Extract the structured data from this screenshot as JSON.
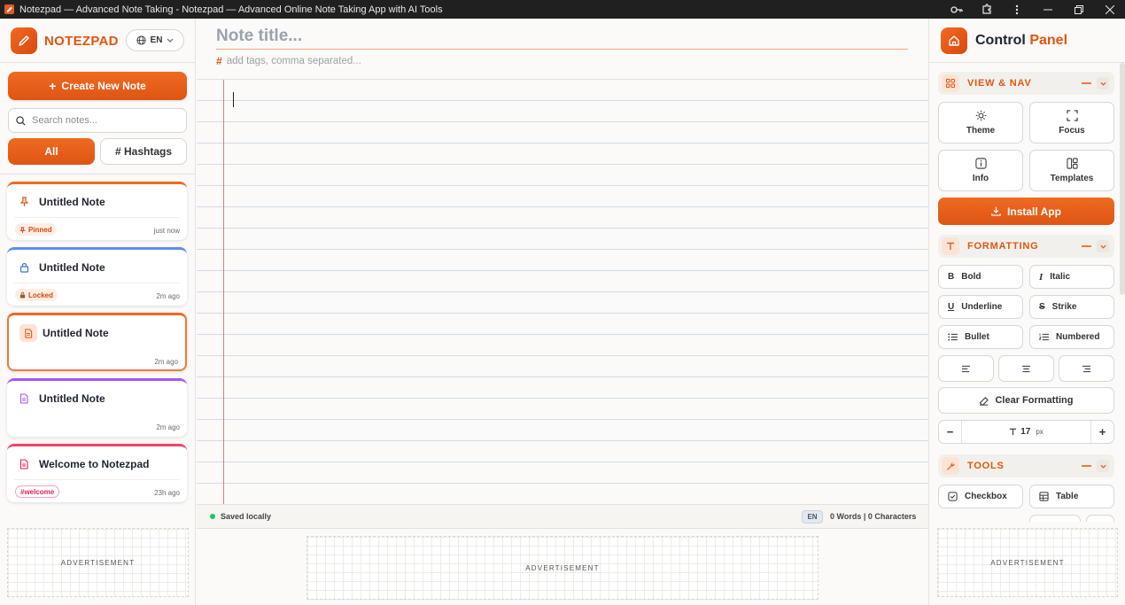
{
  "window": {
    "title": "Notezpad — Advanced Note Taking - Notezpad — Advanced Online Note Taking App with AI Tools"
  },
  "sidebar": {
    "brand": "NOTEZPAD",
    "language": "EN",
    "create_label": "Create New Note",
    "search_placeholder": "Search notes...",
    "filters": {
      "all": "All",
      "hashtags": "# Hashtags"
    },
    "notes": [
      {
        "title": "Untitled Note",
        "icon": "pin-icon",
        "badge": "Pinned",
        "time": "just now",
        "accent": "#ef6a22"
      },
      {
        "title": "Untitled Note",
        "icon": "lock-icon",
        "badge": "Locked",
        "time": "2m ago",
        "accent": "#5b8def"
      },
      {
        "title": "Untitled Note",
        "icon": "document-icon",
        "badge": "",
        "time": "2m ago",
        "accent": "#ef6a22"
      },
      {
        "title": "Untitled Note",
        "icon": "document-icon",
        "badge": "",
        "time": "2m ago",
        "accent": "#a855f7"
      },
      {
        "title": "Welcome to Notezpad",
        "icon": "document-icon",
        "badge": "#welcome",
        "time": "23h ago",
        "accent": "#f0436a"
      }
    ],
    "ad_label": "ADVERTISEMENT"
  },
  "editor": {
    "title_placeholder": "Note title...",
    "tags_placeholder": "add tags, comma separated...",
    "status": "Saved locally",
    "language": "EN",
    "counts": "0 Words | 0 Characters",
    "ad_label": "ADVERTISEMENT"
  },
  "panel": {
    "title_part1": "Control",
    "title_part2": "Panel",
    "view_nav": {
      "label": "VIEW & NAV",
      "theme": "Theme",
      "focus": "Focus",
      "info": "Info",
      "templates": "Templates"
    },
    "install_label": "Install App",
    "formatting": {
      "label": "FORMATTING",
      "bold": "Bold",
      "italic": "Italic",
      "underline": "Underline",
      "strike": "Strike",
      "bullet": "Bullet",
      "numbered": "Numbered",
      "clear": "Clear Formatting",
      "font_size": "17",
      "font_unit": "px"
    },
    "tools": {
      "label": "TOOLS",
      "checkbox": "Checkbox",
      "table": "Table"
    },
    "ad_label": "ADVERTISEMENT"
  },
  "colors": {
    "accent": "#e2550f",
    "accent_gradient_start": "#f06a22",
    "saved_dot": "#22c55e",
    "margin_line": "#e8787a"
  }
}
